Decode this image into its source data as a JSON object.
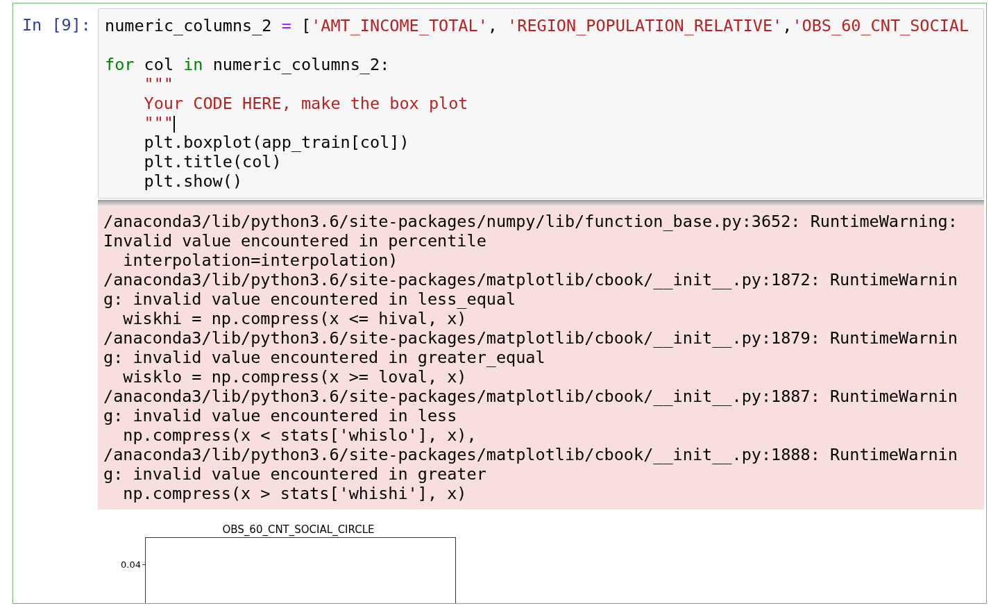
{
  "cell": {
    "prompt": "In [9]:",
    "code_lines": [
      {
        "indent": false,
        "gap_after": true,
        "tokens": [
          {
            "kind": "plain",
            "text": "numeric_columns_2 "
          },
          {
            "kind": "operator",
            "text": "="
          },
          {
            "kind": "plain",
            "text": " ["
          },
          {
            "kind": "string",
            "text": "'AMT_INCOME_TOTAL'"
          },
          {
            "kind": "plain",
            "text": ", "
          },
          {
            "kind": "string",
            "text": "'REGION_POPULATION_RELATIVE'"
          },
          {
            "kind": "plain",
            "text": ","
          },
          {
            "kind": "string",
            "text": "'OBS_60_CNT_SOCIAL"
          }
        ]
      },
      {
        "indent": false,
        "tokens": [
          {
            "kind": "keyword",
            "text": "for"
          },
          {
            "kind": "plain",
            "text": " col "
          },
          {
            "kind": "keyword",
            "text": "in"
          },
          {
            "kind": "plain",
            "text": " numeric_columns_2:"
          }
        ]
      },
      {
        "indent": true,
        "tokens": [
          {
            "kind": "string",
            "text": "\"\"\""
          }
        ]
      },
      {
        "indent": true,
        "tokens": [
          {
            "kind": "string",
            "text": "Your CODE HERE, make the box plot"
          }
        ]
      },
      {
        "indent": true,
        "tokens": [
          {
            "kind": "string",
            "text": "\"\"\""
          },
          {
            "kind": "cursor"
          }
        ]
      },
      {
        "indent": true,
        "tokens": [
          {
            "kind": "plain",
            "text": "plt.boxplot(app_train[col])"
          }
        ]
      },
      {
        "indent": true,
        "tokens": [
          {
            "kind": "plain",
            "text": "plt.title(col)"
          }
        ]
      },
      {
        "indent": true,
        "tokens": [
          {
            "kind": "plain",
            "text": "plt.show()"
          }
        ]
      }
    ],
    "stderr_lines": [
      "/anaconda3/lib/python3.6/site-packages/numpy/lib/function_base.py:3652: RuntimeWarning:",
      "Invalid value encountered in percentile",
      "  interpolation=interpolation)",
      "/anaconda3/lib/python3.6/site-packages/matplotlib/cbook/__init__.py:1872: RuntimeWarnin",
      "g: invalid value encountered in less_equal",
      "  wiskhi = np.compress(x <= hival, x)",
      "/anaconda3/lib/python3.6/site-packages/matplotlib/cbook/__init__.py:1879: RuntimeWarnin",
      "g: invalid value encountered in greater_equal",
      "  wisklo = np.compress(x >= loval, x)",
      "/anaconda3/lib/python3.6/site-packages/matplotlib/cbook/__init__.py:1887: RuntimeWarnin",
      "g: invalid value encountered in less",
      "  np.compress(x < stats['whislo'], x),",
      "/anaconda3/lib/python3.6/site-packages/matplotlib/cbook/__init__.py:1888: RuntimeWarnin",
      "g: invalid value encountered in greater",
      "  np.compress(x > stats['whishi'], x)"
    ],
    "plot": {
      "title": "OBS_60_CNT_SOCIAL_CIRCLE",
      "ytick_labels": [
        "0.04"
      ]
    }
  }
}
